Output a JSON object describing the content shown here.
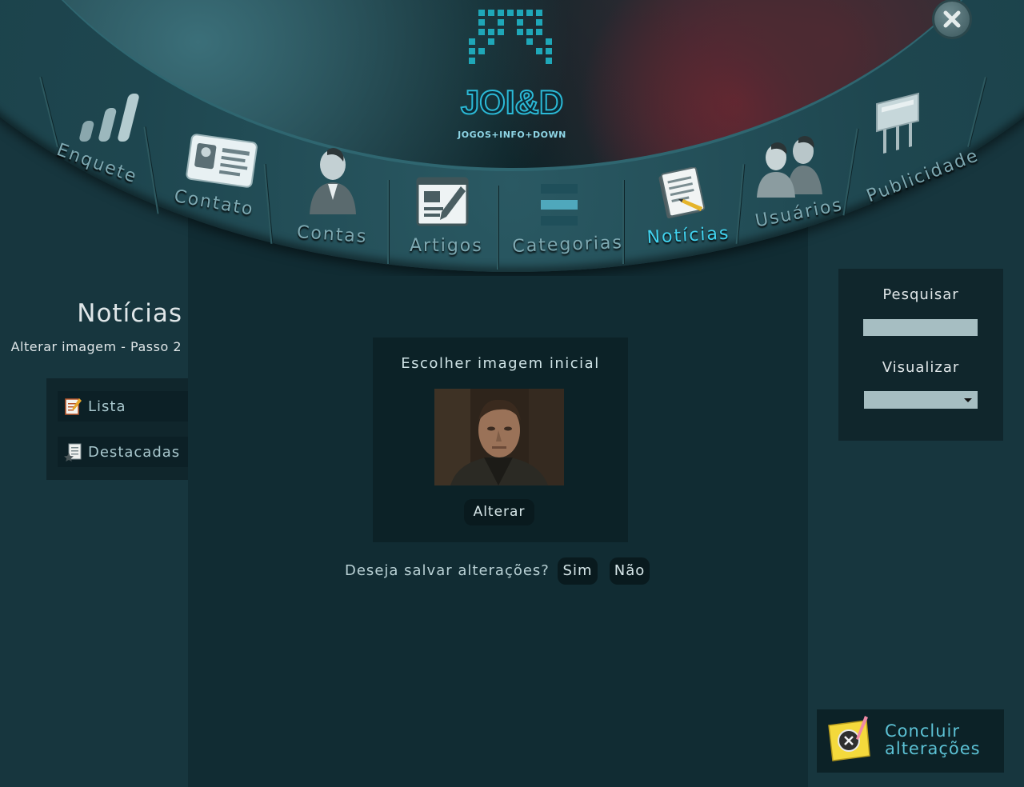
{
  "header": {
    "logo_text": "JOI&D",
    "logo_subtitle": "JOGOS+INFO+DOWN",
    "nav": [
      {
        "label": "Enquete",
        "icon": "bar-chart-icon",
        "active": false
      },
      {
        "label": "Contato",
        "icon": "contact-card-icon",
        "active": false
      },
      {
        "label": "Contas",
        "icon": "user-icon",
        "active": false
      },
      {
        "label": "Artigos",
        "icon": "article-edit-icon",
        "active": false
      },
      {
        "label": "Categorias",
        "icon": "categories-icon",
        "active": false
      },
      {
        "label": "Notícias",
        "icon": "news-icon",
        "active": true
      },
      {
        "label": "Usuários",
        "icon": "users-icon",
        "active": false
      },
      {
        "label": "Publicidade",
        "icon": "billboard-icon",
        "active": false
      }
    ]
  },
  "sidebar": {
    "title": "Notícias",
    "subtitle": "Alterar imagem - Passo 2",
    "items": [
      {
        "label": "Lista",
        "icon": "list-edit-icon"
      },
      {
        "label": "Destacadas",
        "icon": "featured-doc-icon"
      }
    ]
  },
  "main": {
    "box_title": "Escolher imagem inicial",
    "change_button": "Alterar",
    "save_question": "Deseja salvar alterações?",
    "yes_button": "Sim",
    "no_button": "Não"
  },
  "right": {
    "search_label": "Pesquisar",
    "search_value": "",
    "view_label": "Visualizar",
    "view_value": "",
    "finish_line1": "Concluir",
    "finish_line2": "alterações"
  },
  "colors": {
    "accent": "#41d3ef",
    "nav_text": "#7ea9b2",
    "main_bg": "#112c33",
    "side_bg": "#17363e"
  }
}
